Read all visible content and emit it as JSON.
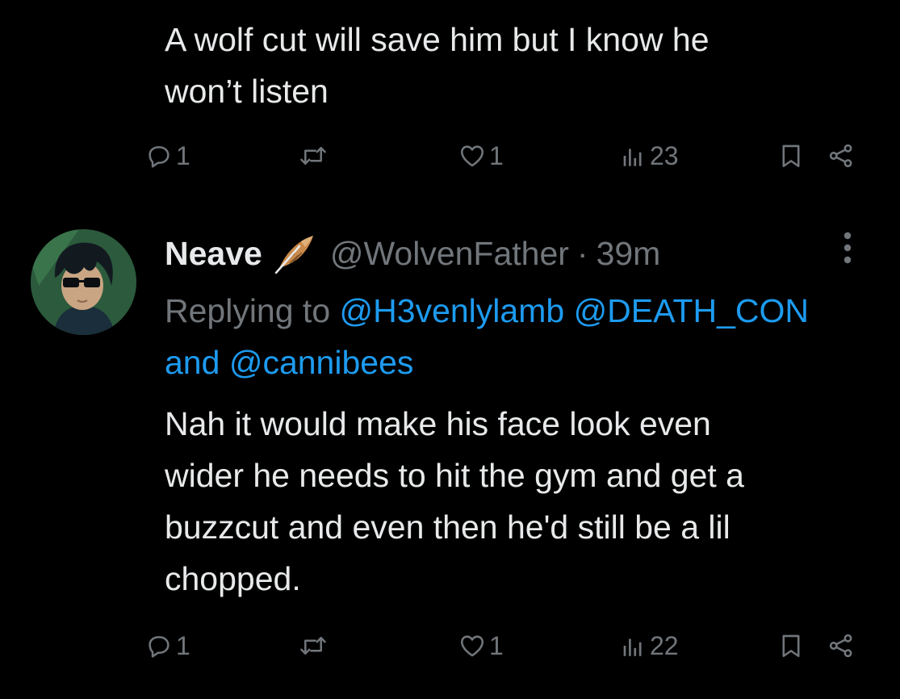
{
  "tweet1": {
    "text": "A wolf cut will save him but I know he\nwon’t listen",
    "actions": {
      "replies": "1",
      "retweets": "",
      "likes": "1",
      "views": "23"
    }
  },
  "tweet2": {
    "author": {
      "display_name": "Neave",
      "emoji": "feather-icon",
      "handle": "@WolvenFather",
      "separator": "·",
      "time": "39m"
    },
    "replying": {
      "prefix": "Replying to",
      "mentions": [
        "@H3venlylamb",
        "@DEATH_CON"
      ],
      "conjunction": "and",
      "last_mention": "@cannibees"
    },
    "text": "Nah it would make his face look even\nwider he needs to hit the gym and get a\nbuzzcut and even then he'd still be a lil\nchopped.",
    "actions": {
      "replies": "1",
      "retweets": "",
      "likes": "1",
      "views": "22"
    }
  },
  "colors": {
    "background": "#000000",
    "text_primary": "#e7e9ea",
    "text_secondary": "#71767b",
    "link": "#1d9bf0"
  }
}
